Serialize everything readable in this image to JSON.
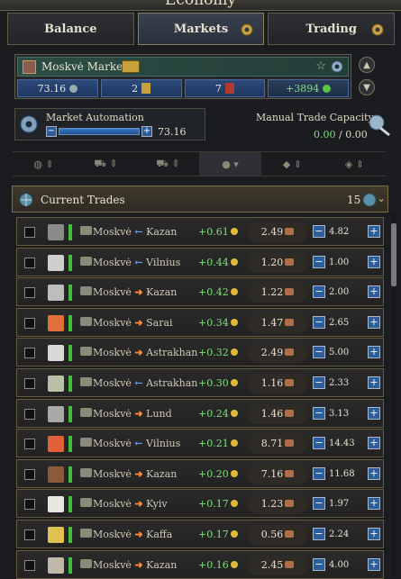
{
  "window": {
    "title": "Economy"
  },
  "tabs": [
    {
      "label": "Balance"
    },
    {
      "label": "Markets"
    },
    {
      "label": "Trading"
    }
  ],
  "market": {
    "name": "Moskvė Market",
    "stats": [
      {
        "value": "73.16"
      },
      {
        "value": "2"
      },
      {
        "value": "7"
      },
      {
        "value": "+3894"
      }
    ]
  },
  "automation": {
    "label": "Market Automation",
    "value": "73.16"
  },
  "capacity": {
    "label": "Manual Trade Capacity",
    "used": "0.00",
    "separator": " / ",
    "total": "0.00"
  },
  "trades": {
    "title": "Current Trades",
    "count": "15",
    "rows": [
      {
        "from": "Moskvė",
        "to": "Kazan",
        "dir": "left",
        "profit": "+0.61",
        "price": "2.49",
        "amount": "4.82",
        "goods_color": "#8a8a8a"
      },
      {
        "from": "Moskvė",
        "to": "Vilnius",
        "dir": "left",
        "profit": "+0.44",
        "price": "1.20",
        "amount": "1.00",
        "goods_color": "#cfcfcf"
      },
      {
        "from": "Moskvė",
        "to": "Kazan",
        "dir": "right",
        "profit": "+0.42",
        "price": "1.22",
        "amount": "2.00",
        "goods_color": "#bdbdbd"
      },
      {
        "from": "Moskvė",
        "to": "Sarai",
        "dir": "right",
        "profit": "+0.34",
        "price": "1.47",
        "amount": "2.65",
        "goods_color": "#e0703a"
      },
      {
        "from": "Moskvė",
        "to": "Astrakhan",
        "dir": "right",
        "profit": "+0.32",
        "price": "2.49",
        "amount": "5.00",
        "goods_color": "#d8d8d8"
      },
      {
        "from": "Moskvė",
        "to": "Astrakhan",
        "dir": "left",
        "profit": "+0.30",
        "price": "1.16",
        "amount": "2.33",
        "goods_color": "#b8c0a8"
      },
      {
        "from": "Moskvė",
        "to": "Lund",
        "dir": "right",
        "profit": "+0.24",
        "price": "1.46",
        "amount": "3.13",
        "goods_color": "#a8a8a8"
      },
      {
        "from": "Moskvė",
        "to": "Vilnius",
        "dir": "left",
        "profit": "+0.21",
        "price": "8.71",
        "amount": "14.43",
        "goods_color": "#e0603a"
      },
      {
        "from": "Moskvė",
        "to": "Kazan",
        "dir": "right",
        "profit": "+0.20",
        "price": "7.16",
        "amount": "11.68",
        "goods_color": "#8a5a3a"
      },
      {
        "from": "Moskvė",
        "to": "Kyiv",
        "dir": "right",
        "profit": "+0.17",
        "price": "1.23",
        "amount": "1.97",
        "goods_color": "#e8e8e0"
      },
      {
        "from": "Moskvė",
        "to": "Kaffa",
        "dir": "right",
        "profit": "+0.17",
        "price": "0.56",
        "amount": "2.24",
        "goods_color": "#e0c050"
      },
      {
        "from": "Moskvė",
        "to": "Kazan",
        "dir": "right",
        "profit": "+0.16",
        "price": "2.45",
        "amount": "4.00",
        "goods_color": "#c0b8a8"
      }
    ]
  }
}
